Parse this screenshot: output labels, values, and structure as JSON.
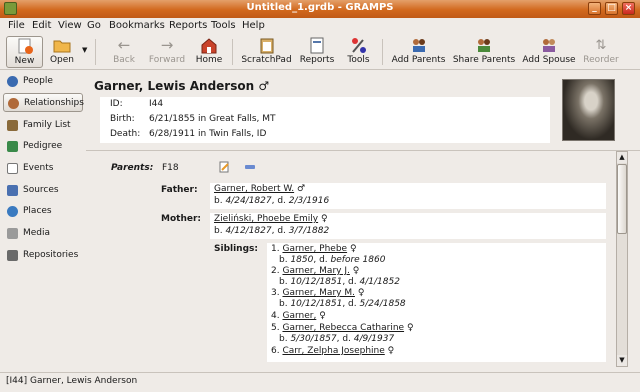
{
  "window": {
    "title": "Untitled_1.grdb - GRAMPS"
  },
  "menu": [
    "File",
    "Edit",
    "View",
    "Go",
    "Bookmarks",
    "Reports",
    "Tools",
    "Help"
  ],
  "toolbar": {
    "new": "New",
    "open": "Open",
    "back": "Back",
    "forward": "Forward",
    "home": "Home",
    "scratchpad": "ScratchPad",
    "reports": "Reports",
    "tools": "Tools",
    "add_parents": "Add Parents",
    "share_parents": "Share Parents",
    "add_spouse": "Add Spouse",
    "reorder": "Reorder"
  },
  "sidebar": [
    "People",
    "Relationships",
    "Family List",
    "Pedigree",
    "Events",
    "Sources",
    "Places",
    "Media",
    "Repositories"
  ],
  "person": {
    "name": "Garner, Lewis Anderson ♂",
    "id_label": "ID:",
    "id": "I44",
    "birth_label": "Birth:",
    "birth": "6/21/1855 in Great Falls, MT",
    "death_label": "Death:",
    "death": "6/28/1911 in Twin Falls, ID"
  },
  "parents": {
    "label": "Parents:",
    "family_id": "F18",
    "father_label": "Father:",
    "father_name": "Garner, Robert W.",
    "father_sex": "♂",
    "father_b": "4/24/1827",
    "father_d": "2/3/1916",
    "mother_label": "Mother:",
    "mother_name": "Zieliński, Phoebe Emily",
    "mother_sex": "♀",
    "mother_b": "4/12/1827",
    "mother_d": "3/7/1882",
    "siblings_label": "Siblings:"
  },
  "siblings": [
    {
      "num": "1.",
      "name": "Garner, Phebe",
      "sex": "♀",
      "b": "1850",
      "d": "before 1860"
    },
    {
      "num": "2.",
      "name": "Garner, Mary J.",
      "sex": "♀",
      "b": "10/12/1851",
      "d": "4/1/1852"
    },
    {
      "num": "3.",
      "name": "Garner, Mary M.",
      "sex": "♀",
      "b": "10/12/1851",
      "d": "5/24/1858"
    },
    {
      "num": "4.",
      "name": "Garner,",
      "sex": "♀",
      "b": "",
      "d": ""
    },
    {
      "num": "5.",
      "name": "Garner, Rebecca Catharine",
      "sex": "♀",
      "b": "5/30/1857",
      "d": "4/9/1937"
    },
    {
      "num": "6.",
      "name": "Carr, Zelpha Josephine",
      "sex": "♀",
      "b": "",
      "d": ""
    }
  ],
  "life": {
    "b_prefix": "b.",
    "d_prefix": ", d."
  },
  "status": "[I44] Garner, Lewis Anderson"
}
